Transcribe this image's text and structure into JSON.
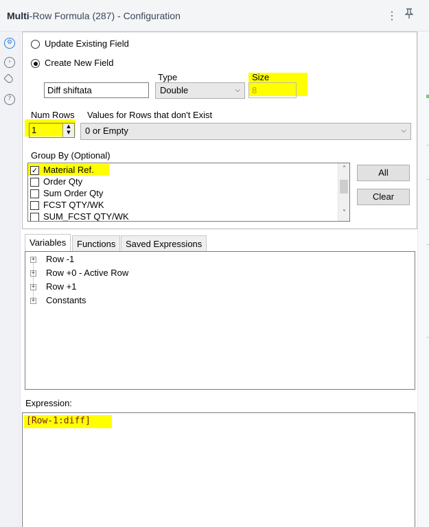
{
  "window": {
    "title_bold": "Multi",
    "title_rest": "-Row Formula (287) - Configuration",
    "menu_icon": "more-vertical-icon",
    "pin_icon": "pin-icon"
  },
  "sidebar": {
    "items": [
      {
        "icon": "gear-icon",
        "active": true
      },
      {
        "icon": "arrow-circle-icon",
        "active": false
      },
      {
        "icon": "tag-icon",
        "active": false
      },
      {
        "icon": "help-icon",
        "active": false
      }
    ]
  },
  "mode": {
    "update_label": "Update Existing Field",
    "create_label": "Create New  Field",
    "selected": "create"
  },
  "field": {
    "type_label": "Type",
    "size_label": "Size",
    "name_value": "Diff shiftata",
    "type_value": "Double",
    "size_value": "8"
  },
  "rows": {
    "num_rows_label": "Num Rows",
    "num_rows_value": "1",
    "values_label": "Values for Rows that don't Exist",
    "values_value": "0 or Empty"
  },
  "groupby": {
    "label": "Group By (Optional)",
    "items": [
      {
        "label": "Material Ref.",
        "checked": true
      },
      {
        "label": "Order Qty",
        "checked": false
      },
      {
        "label": "Sum Order Qty",
        "checked": false
      },
      {
        "label": "FCST QTY/WK",
        "checked": false
      },
      {
        "label": "SUM_FCST QTY/WK",
        "checked": false
      }
    ],
    "all_button": "All",
    "clear_button": "Clear"
  },
  "tabs": [
    "Variables",
    "Functions",
    "Saved Expressions"
  ],
  "variables": [
    "Row -1",
    "Row +0 - Active Row",
    "Row +1",
    "Constants"
  ],
  "expression": {
    "label": "Expression:",
    "value": "[Row-1:diff]"
  },
  "colors": {
    "highlight": "#ffff00",
    "accent": "#2a7bd8"
  }
}
